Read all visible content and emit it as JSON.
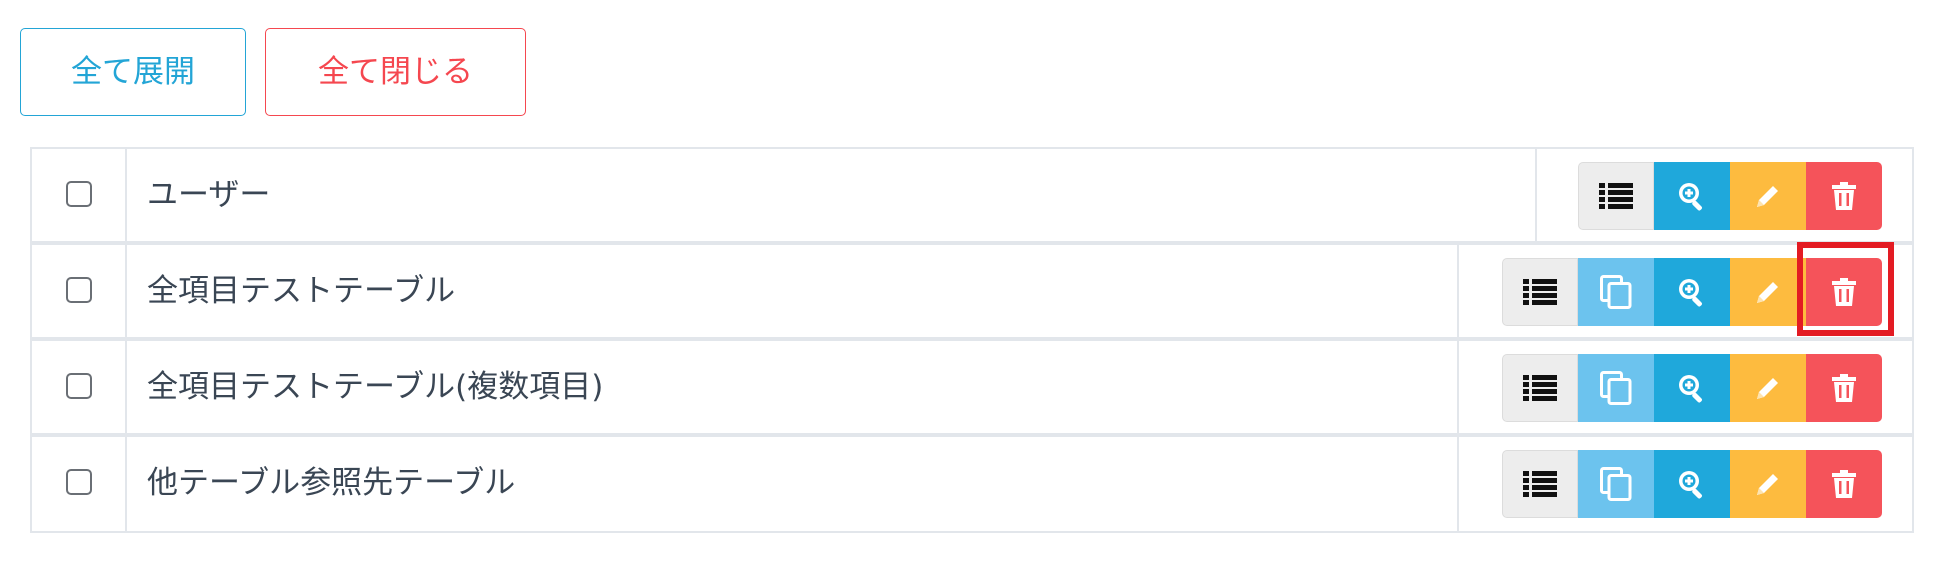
{
  "toolbar": {
    "expand_all_label": "全て展開",
    "collapse_all_label": "全て閉じる"
  },
  "tables": [
    {
      "name": "ユーザー",
      "has_copy": false
    },
    {
      "name": "全項目テストテーブル",
      "has_copy": true
    },
    {
      "name": "全項目テストテーブル(複数項目)",
      "has_copy": true
    },
    {
      "name": "他テーブル参照先テーブル",
      "has_copy": true
    }
  ],
  "icons": {
    "list": "list-icon",
    "copy": "copy-icon",
    "view": "zoom-in-icon",
    "edit": "pencil-icon",
    "delete": "trash-icon"
  },
  "colors": {
    "info": "#1fa8db",
    "info_light": "#6cc3ee",
    "warning": "#fdbb3f",
    "danger": "#f5535a",
    "default": "#ededed",
    "highlight": "#e31b23"
  }
}
